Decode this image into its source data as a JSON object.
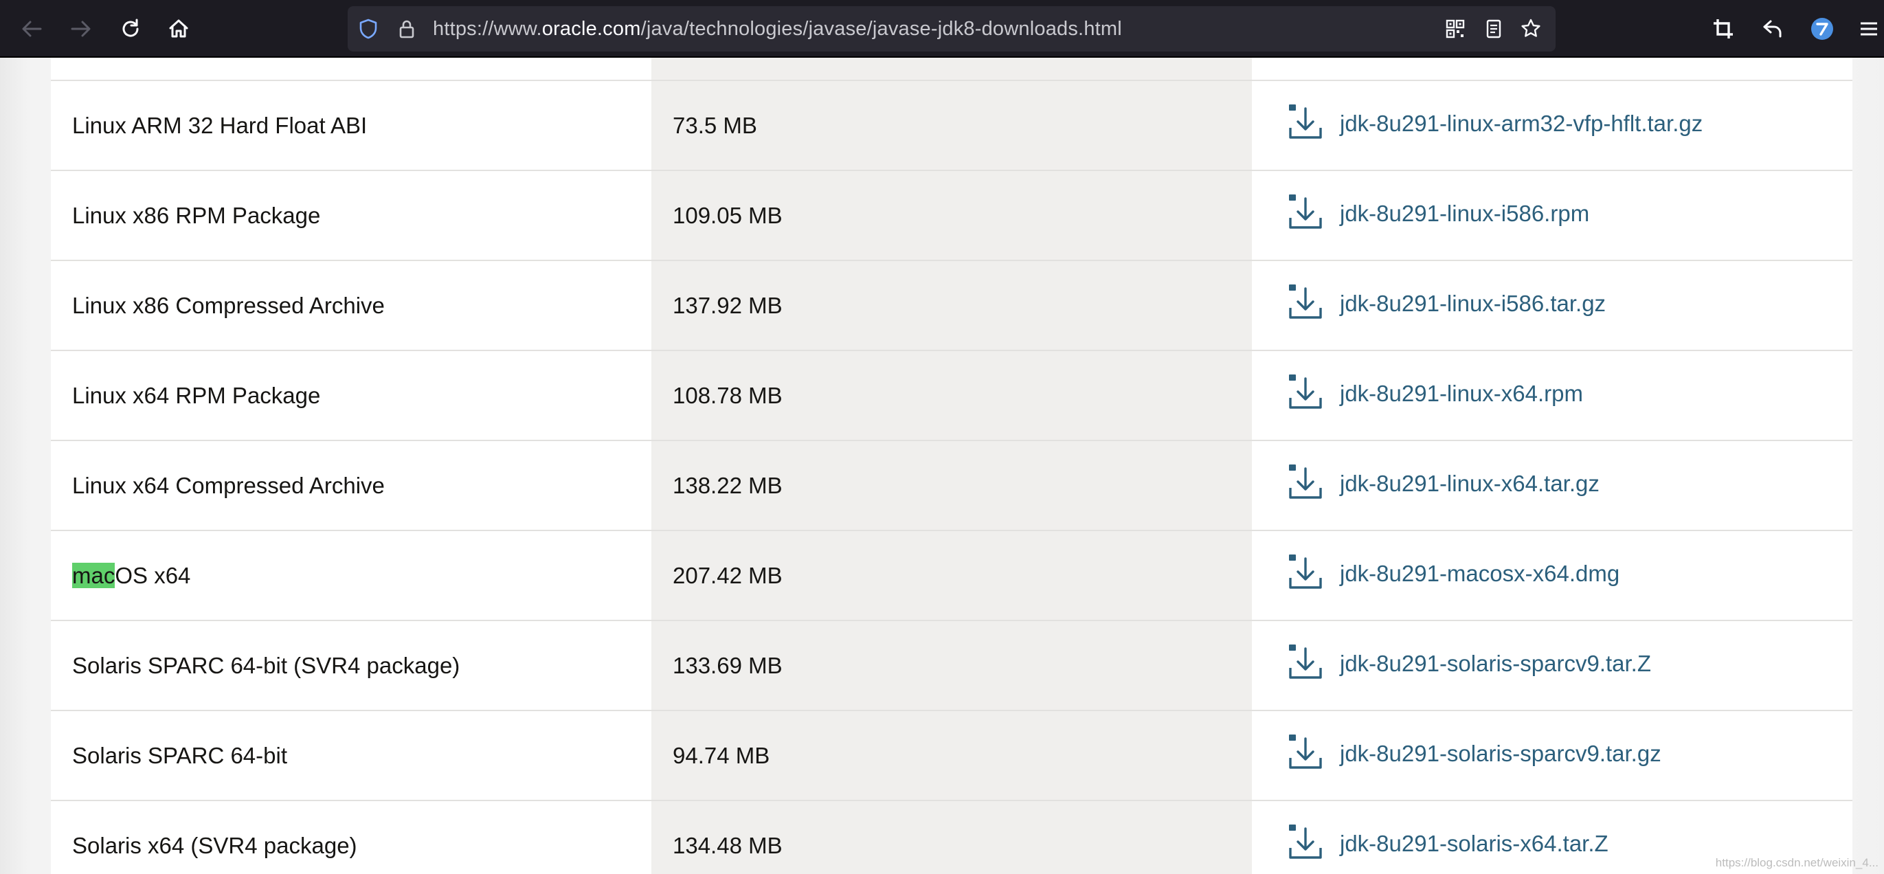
{
  "browser": {
    "url_prefix": "https://www.",
    "url_domain": "oracle.com",
    "url_path": "/java/technologies/javase/javase-jdk8-downloads.html"
  },
  "rows": [
    {
      "name": "Linux ARM 32 Hard Float ABI",
      "size": "73.5 MB",
      "file": "jdk-8u291-linux-arm32-vfp-hflt.tar.gz"
    },
    {
      "name": "Linux x86 RPM Package",
      "size": "109.05 MB",
      "file": "jdk-8u291-linux-i586.rpm"
    },
    {
      "name": "Linux x86 Compressed Archive",
      "size": "137.92 MB",
      "file": "jdk-8u291-linux-i586.tar.gz"
    },
    {
      "name": "Linux x64 RPM Package",
      "size": "108.78 MB",
      "file": "jdk-8u291-linux-x64.rpm"
    },
    {
      "name": "Linux x64 Compressed Archive",
      "size": "138.22 MB",
      "file": "jdk-8u291-linux-x64.tar.gz"
    },
    {
      "name_highlight": "mac",
      "name_rest": "OS x64",
      "size": "207.42 MB",
      "file": "jdk-8u291-macosx-x64.dmg"
    },
    {
      "name": "Solaris SPARC 64-bit (SVR4 package)",
      "size": "133.69 MB",
      "file": "jdk-8u291-solaris-sparcv9.tar.Z"
    },
    {
      "name": "Solaris SPARC 64-bit",
      "size": "94.74 MB",
      "file": "jdk-8u291-solaris-sparcv9.tar.gz"
    },
    {
      "name": "Solaris x64 (SVR4 package)",
      "size": "134.48 MB",
      "file": "jdk-8u291-solaris-x64.tar.Z"
    }
  ],
  "watermark": "https://blog.csdn.net/weixin_4..."
}
